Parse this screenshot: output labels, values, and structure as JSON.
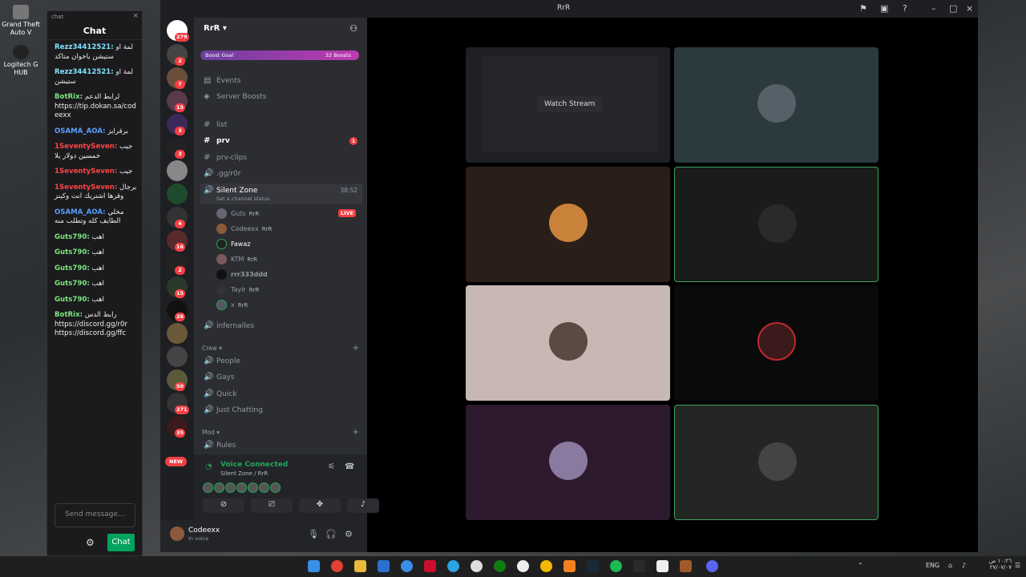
{
  "desktop": {
    "icons": [
      {
        "label": "Grand Theft Auto V"
      },
      {
        "label": "Logitech G HUB"
      }
    ]
  },
  "chat_panel": {
    "window_label": "chat",
    "title": "Chat",
    "messages": [
      {
        "user": "Rezz34412521:",
        "text": "لمة او ستيشن ياخوان متاكد",
        "color": "#7ee3ff"
      },
      {
        "user": "Rezz34412521:",
        "text": "لمة او ستيشن",
        "color": "#7ee3ff"
      },
      {
        "user": "BotRix:",
        "text": "لرابط الدعم https://tip.dokan.sa/codeexx",
        "color": "#7ee37e"
      },
      {
        "user": "OSAMA_AOA:",
        "text": "برقرايز",
        "color": "#5a9dff"
      },
      {
        "user": "1SeventySeven:",
        "text": "جيب خمسين دولار يلا",
        "color": "#ff4444"
      },
      {
        "user": "1SeventySeven:",
        "text": "جيب",
        "color": "#ff4444"
      },
      {
        "user": "1SeventySeven:",
        "text": "برجال وقرها اشتريك انت وكينز",
        "color": "#ff4444"
      },
      {
        "user": "OSAMA_AOA:",
        "text": "مخلي الطايف كله وتطلب منه",
        "color": "#5a9dff"
      },
      {
        "user": "Guts790:",
        "text": "اهب",
        "color": "#7ee37e"
      },
      {
        "user": "Guts790:",
        "text": "اهب",
        "color": "#7ee37e"
      },
      {
        "user": "Guts790:",
        "text": "اهب",
        "color": "#7ee37e"
      },
      {
        "user": "Guts790:",
        "text": "اهب",
        "color": "#7ee37e"
      },
      {
        "user": "Guts790:",
        "text": "اهب",
        "color": "#7ee37e"
      },
      {
        "user": "BotRix:",
        "text": "رابط الدس https://discord.gg/r0r https://discord.gg/ffc",
        "color": "#7ee37e"
      }
    ],
    "input_placeholder": "Send message...",
    "send_label": "Chat"
  },
  "window": {
    "title": "RrR"
  },
  "servers": {
    "badges": [
      "279",
      "2",
      "7",
      "15",
      "3",
      "3",
      "4",
      "16",
      "2",
      "15",
      "26",
      "50",
      "271",
      "35"
    ],
    "new_label": "NEW"
  },
  "sidebar": {
    "server_name": "RrR",
    "boost_goal": "Boost Goal",
    "boost_count": "32 Boosts",
    "top_items": [
      {
        "label": "Events"
      },
      {
        "label": "Server Boosts"
      }
    ],
    "channels": [
      {
        "name": "list",
        "kind": "text"
      },
      {
        "name": "prv",
        "kind": "text",
        "unread": "1"
      },
      {
        "name": "prv-clips",
        "kind": "text"
      },
      {
        "name": ".gg/r0r",
        "kind": "voice"
      }
    ],
    "active_voice": {
      "name": "Silent Zone",
      "status": "Set a channel status",
      "time": "38:52"
    },
    "voice_users": [
      {
        "name": "Guts",
        "tag": "RrR",
        "live": "LIVE"
      },
      {
        "name": "Codeexx",
        "tag": "RrR"
      },
      {
        "name": "Fawaz",
        "tag": ""
      },
      {
        "name": "KTM",
        "tag": "RrR"
      },
      {
        "name": "rrr333ddd",
        "tag": ""
      },
      {
        "name": "Taylr",
        "tag": "RrR"
      },
      {
        "name": "x",
        "tag": "RrR"
      }
    ],
    "after_channel": "infernalles",
    "crew_label": "Crew",
    "crew_channels": [
      "People",
      "Gays",
      "Quick",
      "Just Chatting"
    ],
    "mod_label": "Mod",
    "mod_channels": [
      "Rules"
    ]
  },
  "voice_panel": {
    "status": "Voice Connected",
    "location": "Silent Zone / RrR"
  },
  "user_bar": {
    "name": "Codeexx",
    "status": "In voice"
  },
  "stage": {
    "watch_label": "Watch Stream"
  },
  "taskbar": {
    "lang": "ENG",
    "time": "١٠:٢٦ ص",
    "date": "٢٧/٠٧/٠٧"
  }
}
